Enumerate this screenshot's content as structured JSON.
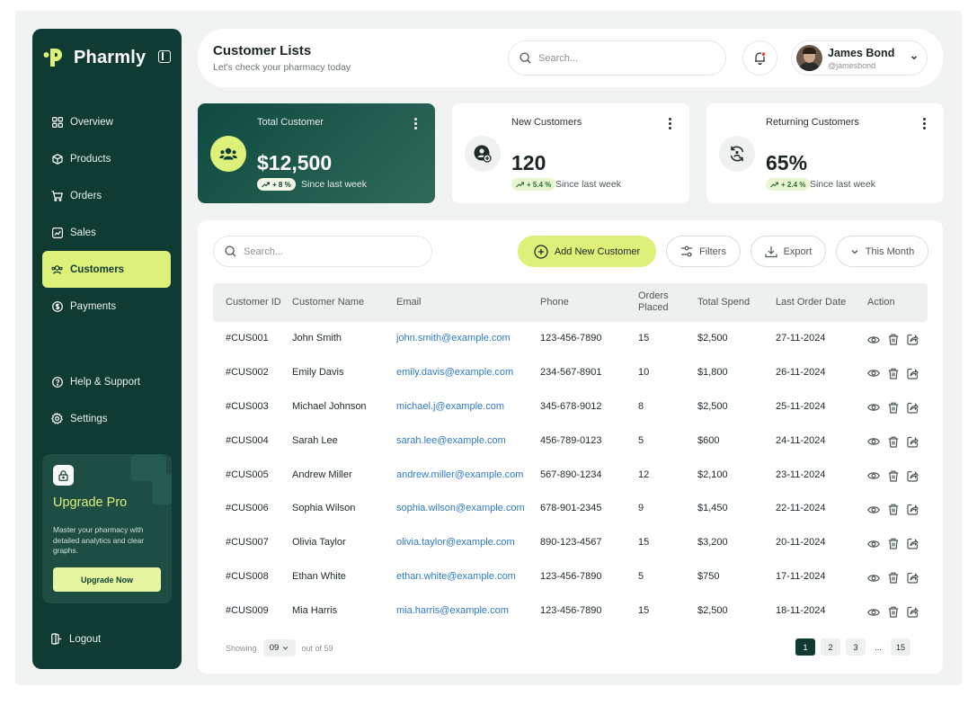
{
  "colors": {
    "sidebar": "#0f3b33",
    "accent": "#dcf07a",
    "link": "#2f7ac3",
    "badge_positive": "#e7f6d0"
  },
  "sidebar": {
    "brand": "Pharmly",
    "items": [
      {
        "label": "Overview",
        "icon": "grid-icon"
      },
      {
        "label": "Products",
        "icon": "box-icon"
      },
      {
        "label": "Orders",
        "icon": "cart-icon"
      },
      {
        "label": "Sales",
        "icon": "chart-icon"
      },
      {
        "label": "Customers",
        "icon": "users-icon",
        "active": true
      },
      {
        "label": "Payments",
        "icon": "dollar-icon"
      }
    ],
    "secondary": [
      {
        "label": "Help & Support",
        "icon": "help-icon"
      },
      {
        "label": "Settings",
        "icon": "gear-icon"
      }
    ],
    "upgrade": {
      "title": "Upgrade Pro",
      "description": "Master your pharmacy with detailed analytics and clear graphs.",
      "button": "Upgrade Now"
    },
    "logout": "Logout"
  },
  "header": {
    "title": "Customer Lists",
    "subtitle": "Let's check your pharmacy today",
    "search_placeholder": "Search...",
    "user": {
      "name": "James Bond",
      "handle": "@jamesbond"
    }
  },
  "stats": [
    {
      "label": "Total Customer",
      "value": "$12,500",
      "change": "+ 8 %",
      "since": "Since last week",
      "icon": "users-icon"
    },
    {
      "label": "New Customers",
      "value": "120",
      "change": "+ 5.4 %",
      "since": "Since last week",
      "icon": "user-add-icon"
    },
    {
      "label": "Returning Customers",
      "value": "65%",
      "change": "+ 2.4 %",
      "since": "Since last week",
      "icon": "refresh-icon"
    }
  ],
  "toolbar": {
    "search_placeholder": "Search...",
    "add_label": "Add New Customer",
    "filters_label": "Filters",
    "export_label": "Export",
    "period_label": "This Month"
  },
  "table": {
    "headers": {
      "id": "Customer ID",
      "name": "Customer Name",
      "email": "Email",
      "phone": "Phone",
      "orders_line1": "Orders",
      "orders_line2": "Placed",
      "spend": "Total Spend",
      "last_order": "Last Order Date",
      "action": "Action"
    },
    "rows": [
      {
        "id": "#CUS001",
        "name": "John Smith",
        "email": "john.smith@example.com",
        "phone": "123-456-7890",
        "orders": "15",
        "spend": "$2,500",
        "date": "27-11-2024"
      },
      {
        "id": "#CUS002",
        "name": "Emily Davis",
        "email": "emily.davis@example.com",
        "phone": "234-567-8901",
        "orders": "10",
        "spend": "$1,800",
        "date": "26-11-2024"
      },
      {
        "id": "#CUS003",
        "name": "Michael Johnson",
        "email": "michael.j@example.com",
        "phone": "345-678-9012",
        "orders": "8",
        "spend": "$2,500",
        "date": "25-11-2024"
      },
      {
        "id": "#CUS004",
        "name": "Sarah Lee",
        "email": "sarah.lee@example.com",
        "phone": "456-789-0123",
        "orders": "5",
        "spend": "$600",
        "date": "24-11-2024"
      },
      {
        "id": "#CUS005",
        "name": "Andrew Miller",
        "email": "andrew.miller@example.com",
        "phone": "567-890-1234",
        "orders": "12",
        "spend": "$2,100",
        "date": "23-11-2024"
      },
      {
        "id": "#CUS006",
        "name": "Sophia Wilson",
        "email": "sophia.wilson@example.com",
        "phone": "678-901-2345",
        "orders": "9",
        "spend": "$1,450",
        "date": "22-11-2024"
      },
      {
        "id": "#CUS007",
        "name": "Olivia Taylor",
        "email": "olivia.taylor@example.com",
        "phone": "890-123-4567",
        "orders": "15",
        "spend": "$3,200",
        "date": "20-11-2024"
      },
      {
        "id": "#CUS008",
        "name": "Ethan White",
        "email": "ethan.white@example.com",
        "phone": "123-456-7890",
        "orders": "5",
        "spend": "$750",
        "date": "17-11-2024"
      },
      {
        "id": "#CUS009",
        "name": "Mia Harris",
        "email": "mia.harris@example.com",
        "phone": "123-456-7890",
        "orders": "15",
        "spend": "$2,500",
        "date": "18-11-2024"
      }
    ]
  },
  "footer": {
    "showing_label": "Showing",
    "page_size": "09",
    "out_of": "out of 59",
    "pages": [
      "1",
      "2",
      "3",
      "...",
      "15"
    ],
    "current_page": "1"
  }
}
